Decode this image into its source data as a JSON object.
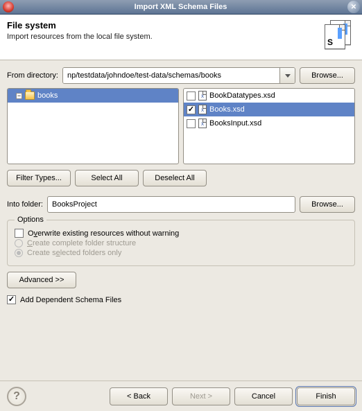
{
  "window": {
    "title": "Import XML Schema Files"
  },
  "header": {
    "title": "File system",
    "description": "Import resources from the local file system."
  },
  "directory": {
    "label": "From directory:",
    "value": "np/testdata/johndoe/test-data/schemas/books",
    "browse": "Browse..."
  },
  "tree": {
    "items": [
      {
        "label": "books",
        "expanded": true,
        "selected": true
      }
    ]
  },
  "files": [
    {
      "label": "BookDatatypes.xsd",
      "checked": false,
      "selected": false
    },
    {
      "label": "Books.xsd",
      "checked": true,
      "selected": true
    },
    {
      "label": "BooksInput.xsd",
      "checked": false,
      "selected": false
    }
  ],
  "buttons": {
    "filter": "Filter Types...",
    "selectAll": "Select All",
    "deselectAll": "Deselect All",
    "advanced": "Advanced >>"
  },
  "intoFolder": {
    "label": "Into folder:",
    "value": "BooksProject",
    "browse": "Browse..."
  },
  "options": {
    "title": "Options",
    "overwrite": {
      "checked": false,
      "pre": "O",
      "u": "v",
      "post": "erwrite existing resources without warning"
    },
    "createComplete": {
      "enabled": false,
      "selected": false,
      "pre": "",
      "u": "C",
      "post": "reate complete folder structure"
    },
    "createSelected": {
      "enabled": false,
      "selected": true,
      "pre": "Create s",
      "u": "e",
      "post": "lected folders only"
    }
  },
  "dependent": {
    "checked": true,
    "label": "Add Dependent Schema Files"
  },
  "footer": {
    "back": "< Back",
    "next": "Next >",
    "cancel": "Cancel",
    "finish": "Finish"
  }
}
